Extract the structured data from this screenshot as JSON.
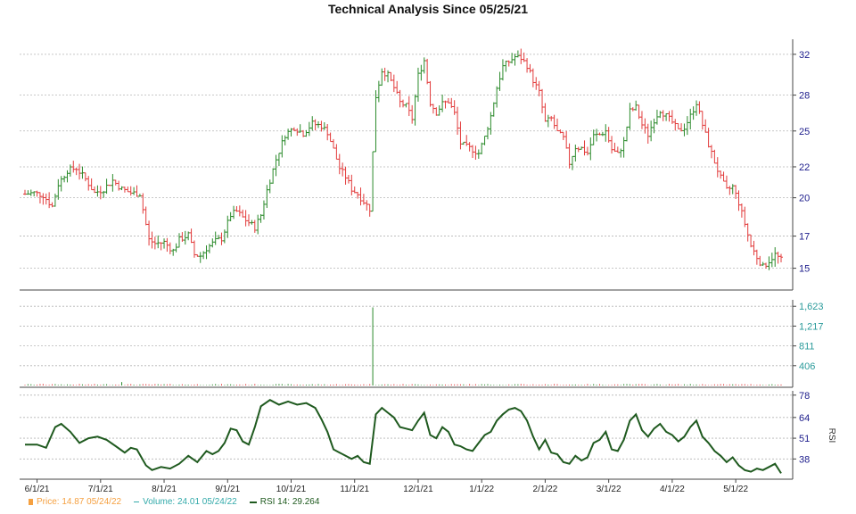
{
  "chart_data": {
    "type": "candlestick",
    "title": "Technical Analysis Since 05/25/21",
    "x_tick_labels": [
      "6/1/21",
      "7/1/21",
      "8/1/21",
      "9/1/21",
      "10/1/21",
      "11/1/21",
      "12/1/21",
      "1/1/22",
      "2/1/22",
      "3/1/22",
      "4/1/22",
      "5/1/22"
    ],
    "price_axis": {
      "ticks": [
        "15",
        "17",
        "20",
        "22",
        "25",
        "28",
        "32"
      ],
      "range": [
        12.8,
        32.5
      ],
      "grid": true
    },
    "volume_axis": {
      "ticks": [
        "406",
        "811",
        "1,217",
        "1,623"
      ],
      "range": [
        0,
        1700
      ]
    },
    "rsi_axis": {
      "label": "RSI",
      "ticks": [
        "38",
        "51",
        "64",
        "78"
      ],
      "range": [
        27,
        79
      ]
    },
    "price_close_path": [
      [
        0,
        20.2
      ],
      [
        3,
        20.3
      ],
      [
        6,
        20.1
      ],
      [
        9,
        19.2
      ],
      [
        11,
        21.0
      ],
      [
        14,
        22.1
      ],
      [
        17,
        22.3
      ],
      [
        20,
        21.4
      ],
      [
        23,
        20.3
      ],
      [
        26,
        20.6
      ],
      [
        29,
        21.3
      ],
      [
        32,
        20.6
      ],
      [
        35,
        20.3
      ],
      [
        38,
        20.2
      ],
      [
        41,
        16.5
      ],
      [
        43,
        16.2
      ],
      [
        46,
        16.3
      ],
      [
        49,
        15.6
      ],
      [
        51,
        16.5
      ],
      [
        54,
        16.9
      ],
      [
        56,
        15.3
      ],
      [
        58,
        15.2
      ],
      [
        60,
        15.8
      ],
      [
        63,
        16.4
      ],
      [
        65,
        16.6
      ],
      [
        68,
        18.5
      ],
      [
        70,
        18.8
      ],
      [
        72,
        18.3
      ],
      [
        74,
        17.9
      ],
      [
        76,
        17.5
      ],
      [
        78,
        18.5
      ],
      [
        80,
        20.5
      ],
      [
        83,
        23.0
      ],
      [
        86,
        25.0
      ],
      [
        89,
        25.6
      ],
      [
        92,
        25.1
      ],
      [
        95,
        25.9
      ],
      [
        98,
        25.7
      ],
      [
        100,
        25.2
      ],
      [
        102,
        23.8
      ],
      [
        104,
        22.3
      ],
      [
        106,
        21.6
      ],
      [
        108,
        20.6
      ],
      [
        110,
        20.2
      ],
      [
        112,
        19.6
      ],
      [
        114,
        19.0
      ],
      [
        116,
        28.1
      ],
      [
        118,
        30.2
      ],
      [
        120,
        29.8
      ],
      [
        122,
        28.8
      ],
      [
        124,
        27.6
      ],
      [
        126,
        27.3
      ],
      [
        128,
        26.3
      ],
      [
        130,
        29.8
      ],
      [
        132,
        31.0
      ],
      [
        134,
        27.6
      ],
      [
        136,
        26.8
      ],
      [
        138,
        27.5
      ],
      [
        140,
        27.7
      ],
      [
        142,
        26.7
      ],
      [
        144,
        24.3
      ],
      [
        146,
        24.0
      ],
      [
        148,
        23.8
      ],
      [
        150,
        23.5
      ],
      [
        152,
        24.8
      ],
      [
        154,
        26.5
      ],
      [
        156,
        28.8
      ],
      [
        158,
        30.5
      ],
      [
        160,
        30.9
      ],
      [
        162,
        31.3
      ],
      [
        164,
        31.2
      ],
      [
        166,
        30.6
      ],
      [
        168,
        29.4
      ],
      [
        170,
        28.4
      ],
      [
        172,
        26.0
      ],
      [
        174,
        26.3
      ],
      [
        176,
        25.2
      ],
      [
        178,
        24.7
      ],
      [
        180,
        22.7
      ],
      [
        182,
        24.0
      ],
      [
        184,
        23.9
      ],
      [
        186,
        23.5
      ],
      [
        188,
        24.9
      ],
      [
        190,
        25.0
      ],
      [
        192,
        25.3
      ],
      [
        194,
        23.8
      ],
      [
        196,
        23.4
      ],
      [
        198,
        24.4
      ],
      [
        200,
        26.9
      ],
      [
        202,
        27.2
      ],
      [
        204,
        25.8
      ],
      [
        206,
        25.0
      ],
      [
        208,
        26.2
      ],
      [
        210,
        27.0
      ],
      [
        212,
        26.5
      ],
      [
        214,
        26.0
      ],
      [
        216,
        25.3
      ],
      [
        218,
        25.6
      ],
      [
        220,
        26.5
      ],
      [
        222,
        27.6
      ],
      [
        224,
        25.8
      ],
      [
        226,
        24.2
      ],
      [
        228,
        22.8
      ],
      [
        230,
        21.5
      ],
      [
        232,
        20.5
      ],
      [
        234,
        20.8
      ],
      [
        236,
        19.5
      ],
      [
        238,
        17.8
      ],
      [
        240,
        16.0
      ],
      [
        242,
        15.1
      ],
      [
        244,
        14.3
      ],
      [
        246,
        14.8
      ],
      [
        248,
        15.3
      ],
      [
        250,
        14.87
      ]
    ],
    "volume_spike": {
      "index": 115,
      "value": 1600
    },
    "rsi_series": [
      [
        0,
        47
      ],
      [
        4,
        47
      ],
      [
        7,
        45
      ],
      [
        10,
        58
      ],
      [
        12,
        60
      ],
      [
        15,
        55
      ],
      [
        18,
        48
      ],
      [
        21,
        51
      ],
      [
        24,
        52
      ],
      [
        27,
        50
      ],
      [
        30,
        46
      ],
      [
        33,
        42
      ],
      [
        35,
        45
      ],
      [
        37,
        44
      ],
      [
        40,
        34
      ],
      [
        42,
        31
      ],
      [
        45,
        33
      ],
      [
        48,
        32
      ],
      [
        51,
        35
      ],
      [
        54,
        40
      ],
      [
        57,
        36
      ],
      [
        60,
        43
      ],
      [
        62,
        41
      ],
      [
        64,
        43
      ],
      [
        66,
        48
      ],
      [
        68,
        57
      ],
      [
        70,
        56
      ],
      [
        72,
        49
      ],
      [
        74,
        47
      ],
      [
        76,
        58
      ],
      [
        78,
        71
      ],
      [
        81,
        75
      ],
      [
        84,
        72
      ],
      [
        87,
        74
      ],
      [
        90,
        72
      ],
      [
        93,
        73
      ],
      [
        96,
        70
      ],
      [
        98,
        63
      ],
      [
        100,
        55
      ],
      [
        102,
        44
      ],
      [
        104,
        42
      ],
      [
        106,
        40
      ],
      [
        108,
        38
      ],
      [
        110,
        40
      ],
      [
        112,
        36
      ],
      [
        114,
        35
      ],
      [
        116,
        66
      ],
      [
        118,
        70
      ],
      [
        120,
        67
      ],
      [
        122,
        64
      ],
      [
        124,
        58
      ],
      [
        126,
        57
      ],
      [
        128,
        56
      ],
      [
        130,
        62
      ],
      [
        132,
        67
      ],
      [
        134,
        53
      ],
      [
        136,
        51
      ],
      [
        138,
        58
      ],
      [
        140,
        55
      ],
      [
        142,
        47
      ],
      [
        144,
        46
      ],
      [
        146,
        44
      ],
      [
        148,
        43
      ],
      [
        150,
        48
      ],
      [
        152,
        53
      ],
      [
        154,
        55
      ],
      [
        156,
        62
      ],
      [
        158,
        66
      ],
      [
        160,
        69
      ],
      [
        162,
        70
      ],
      [
        164,
        68
      ],
      [
        166,
        62
      ],
      [
        168,
        52
      ],
      [
        170,
        44
      ],
      [
        172,
        50
      ],
      [
        174,
        42
      ],
      [
        176,
        41
      ],
      [
        178,
        36
      ],
      [
        180,
        35
      ],
      [
        182,
        40
      ],
      [
        184,
        37
      ],
      [
        186,
        39
      ],
      [
        188,
        48
      ],
      [
        190,
        50
      ],
      [
        192,
        55
      ],
      [
        194,
        44
      ],
      [
        196,
        43
      ],
      [
        198,
        50
      ],
      [
        200,
        62
      ],
      [
        202,
        66
      ],
      [
        204,
        56
      ],
      [
        206,
        52
      ],
      [
        208,
        57
      ],
      [
        210,
        60
      ],
      [
        212,
        55
      ],
      [
        214,
        53
      ],
      [
        216,
        49
      ],
      [
        218,
        52
      ],
      [
        220,
        58
      ],
      [
        222,
        62
      ],
      [
        224,
        52
      ],
      [
        226,
        48
      ],
      [
        228,
        43
      ],
      [
        230,
        40
      ],
      [
        232,
        36
      ],
      [
        234,
        39
      ],
      [
        236,
        34
      ],
      [
        238,
        31
      ],
      [
        240,
        30
      ],
      [
        242,
        32
      ],
      [
        244,
        31
      ],
      [
        246,
        33
      ],
      [
        248,
        35
      ],
      [
        250,
        29
      ]
    ],
    "colors": {
      "up": "#2a8a2a",
      "down": "#e23b3b",
      "rsi": "#1f5a1f",
      "grid": "#b5b5b5",
      "axis_text": "#1a1a8a",
      "volume_text": "#2a9a9a"
    }
  },
  "legend": {
    "price": "Price: 14.87  05/24/22",
    "volume": "Volume: 24.01  05/24/22",
    "rsi": "RSI 14: 29.264"
  }
}
